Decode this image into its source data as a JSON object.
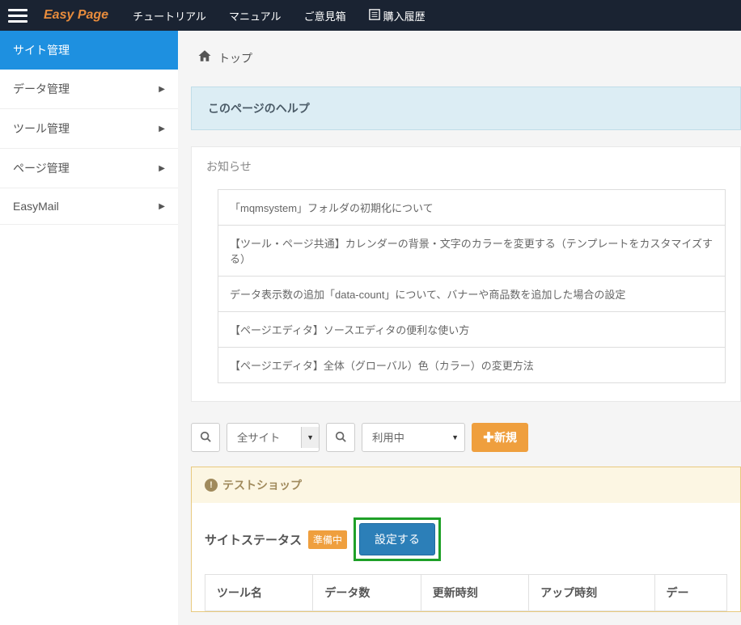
{
  "brand": "Easy Page",
  "topnav": {
    "items": [
      {
        "label": "チュートリアル"
      },
      {
        "label": "マニュアル"
      },
      {
        "label": "ご意見箱"
      },
      {
        "label": "購入履歴",
        "has_icon": true
      }
    ]
  },
  "sidebar": {
    "items": [
      {
        "label": "サイト管理",
        "active": true
      },
      {
        "label": "データ管理"
      },
      {
        "label": "ツール管理"
      },
      {
        "label": "ページ管理"
      },
      {
        "label": "EasyMail"
      }
    ]
  },
  "breadcrumb": {
    "label": "トップ"
  },
  "help_panel_title": "このページのヘルプ",
  "news": {
    "title": "お知らせ",
    "items": [
      "「mqmsystem」フォルダの初期化について",
      "【ツール・ページ共通】カレンダーの背景・文字のカラーを変更する（テンプレートをカスタマイズする）",
      "データ表示数の追加「data-count」について、バナーや商品数を追加した場合の設定",
      "【ページエディタ】ソースエディタの便利な使い方",
      "【ページエディタ】全体（グローバル）色（カラー）の変更方法"
    ]
  },
  "toolbar": {
    "site_select": "全サイト",
    "status_select": "利用中",
    "new_label": "新規"
  },
  "shop_card": {
    "title": "テストショップ",
    "status_label": "サイトステータス",
    "badge": "準備中",
    "settings_btn": "設定する",
    "columns": [
      "ツール名",
      "データ数",
      "更新時刻",
      "アップ時刻",
      "デー"
    ]
  }
}
